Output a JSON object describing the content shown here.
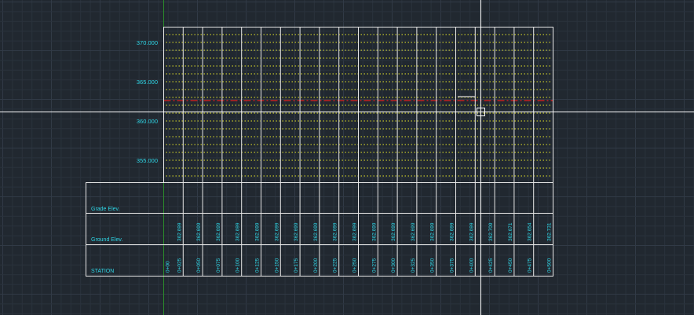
{
  "colors": {
    "background": "#212830",
    "grid_minor": "#2a323c",
    "grid_major": "#313a46",
    "frame": "#e8e8e8",
    "dotted": "#e6e62a",
    "design_line": "#e01e1e",
    "text": "#2fd6e6",
    "ucs_axis": "#2a8a2a",
    "crosshair": "#ffffff"
  },
  "profile": {
    "elevation_labels": [
      "370.000",
      "365.000",
      "360.000",
      "355.000"
    ],
    "design_elevation": 362.6
  },
  "table": {
    "row_labels": {
      "grade": "Grade Elev.",
      "ground": "Ground Elev.",
      "station": "STATION"
    },
    "ground_elevations": [
      "362.699",
      "362.699",
      "362.699",
      "362.699",
      "362.699",
      "362.699",
      "362.699",
      "362.699",
      "362.699",
      "362.699",
      "362.699",
      "362.699",
      "362.699",
      "362.699",
      "362.699",
      "362.699",
      "362.709",
      "362.671",
      "362.654",
      "362.731"
    ],
    "stations": [
      "0+00",
      "0+025",
      "0+050",
      "0+075",
      "0+100",
      "0+125",
      "0+150",
      "0+175",
      "0+200",
      "0+225",
      "0+250",
      "0+275",
      "0+300",
      "0+325",
      "0+350",
      "0+375",
      "0+400",
      "0+425",
      "0+450",
      "0+475",
      "0+500"
    ]
  },
  "cursor": {
    "pickbox": "cursor-pickbox-icon"
  }
}
